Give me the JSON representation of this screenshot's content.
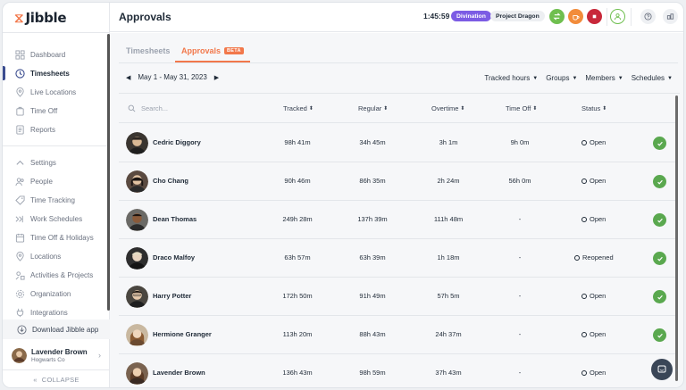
{
  "app": {
    "logo_text": "Jibble"
  },
  "sidebar": {
    "items": [
      {
        "label": "Dashboard",
        "icon": "grid-icon",
        "active": false
      },
      {
        "label": "Timesheets",
        "icon": "clock-icon",
        "active": true
      },
      {
        "label": "Live Locations",
        "icon": "location-pin-icon",
        "active": false
      },
      {
        "label": "Time Off",
        "icon": "suitcase-icon",
        "active": false
      },
      {
        "label": "Reports",
        "icon": "document-icon",
        "active": false
      }
    ],
    "settings_items": [
      {
        "label": "Settings",
        "icon": "chevron-up-icon"
      },
      {
        "label": "People",
        "icon": "people-icon"
      },
      {
        "label": "Time Tracking",
        "icon": "tag-icon"
      },
      {
        "label": "Work Schedules",
        "icon": "schedule-icon"
      },
      {
        "label": "Time Off & Holidays",
        "icon": "calendar-icon"
      },
      {
        "label": "Locations",
        "icon": "location-pin-icon"
      },
      {
        "label": "Activities & Projects",
        "icon": "activities-icon"
      },
      {
        "label": "Organization",
        "icon": "gear-icon"
      },
      {
        "label": "Integrations",
        "icon": "plug-icon"
      }
    ],
    "download_label": "Download Jibble app",
    "user": {
      "name": "Lavender Brown",
      "org": "Hogwarts Co"
    },
    "collapse_label": "COLLAPSE"
  },
  "header": {
    "title": "Approvals",
    "timer": "1:45:59",
    "activity": "Divination",
    "project": "Project Dragon"
  },
  "tabs": {
    "timesheets": "Timesheets",
    "approvals": "Approvals",
    "approvals_badge": "BETA"
  },
  "date_range": "May 1 - May 31, 2023",
  "filters": [
    "Tracked hours",
    "Groups",
    "Members",
    "Schedules"
  ],
  "table": {
    "search_placeholder": "Search...",
    "columns": [
      "Tracked",
      "Regular",
      "Overtime",
      "Time Off",
      "Status"
    ],
    "rows": [
      {
        "name": "Cedric Diggory",
        "tracked": "98h 41m",
        "regular": "34h 45m",
        "overtime": "3h 1m",
        "time_off": "9h 0m",
        "status": "Open",
        "approved": true
      },
      {
        "name": "Cho Chang",
        "tracked": "90h 46m",
        "regular": "86h 35m",
        "overtime": "2h 24m",
        "time_off": "56h 0m",
        "status": "Open",
        "approved": true
      },
      {
        "name": "Dean Thomas",
        "tracked": "249h 28m",
        "regular": "137h 39m",
        "overtime": "111h 48m",
        "time_off": "-",
        "status": "Open",
        "approved": true
      },
      {
        "name": "Draco Malfoy",
        "tracked": "63h 57m",
        "regular": "63h 39m",
        "overtime": "1h 18m",
        "time_off": "-",
        "status": "Reopened",
        "approved": true
      },
      {
        "name": "Harry Potter",
        "tracked": "172h 50m",
        "regular": "91h 49m",
        "overtime": "57h 5m",
        "time_off": "-",
        "status": "Open",
        "approved": true
      },
      {
        "name": "Hermione Granger",
        "tracked": "113h 20m",
        "regular": "88h 43m",
        "overtime": "24h 37m",
        "time_off": "-",
        "status": "Open",
        "approved": true
      },
      {
        "name": "Lavender Brown",
        "tracked": "136h 43m",
        "regular": "98h 59m",
        "overtime": "37h 43m",
        "time_off": "-",
        "status": "Open",
        "approved": false
      }
    ]
  },
  "colors": {
    "accent": "#f2784b",
    "activity_chip": "#7c5ce4",
    "approved_green": "#5aa84f",
    "header_green": "#6fbf4f",
    "header_orange": "#f28c3b",
    "header_red": "#c8283a"
  }
}
